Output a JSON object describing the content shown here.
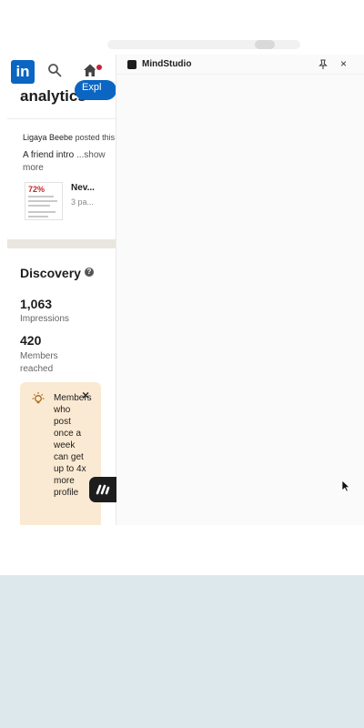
{
  "linkedin": {
    "logo_text": "in",
    "section_heading": "analytics",
    "explore_label": "Expl",
    "post": {
      "poster_name": "Ligaya Beebe",
      "poster_action": "posted this",
      "snippet": "A friend intro",
      "show_more": "...show more",
      "doc_thumb_text": "72%",
      "doc_title": "Nev...",
      "doc_pages": "3 pa..."
    },
    "discovery": {
      "title": "Discovery",
      "help_symbol": "?",
      "impressions_value": "1,063",
      "impressions_label": "Impressions",
      "members_value": "420",
      "members_label": "Members reached"
    },
    "tip": {
      "text": "Members who post once a week can get up to 4x more profile",
      "close_symbol": "×"
    }
  },
  "mindstudio": {
    "title": "MindStudio",
    "pin_icon": "pin-icon",
    "close_symbol": "×"
  },
  "colors": {
    "linkedin_blue": "#0a66c2",
    "notification_red": "#c9203a",
    "tip_background": "#fbead3",
    "bottom_band": "#dde8ed"
  }
}
